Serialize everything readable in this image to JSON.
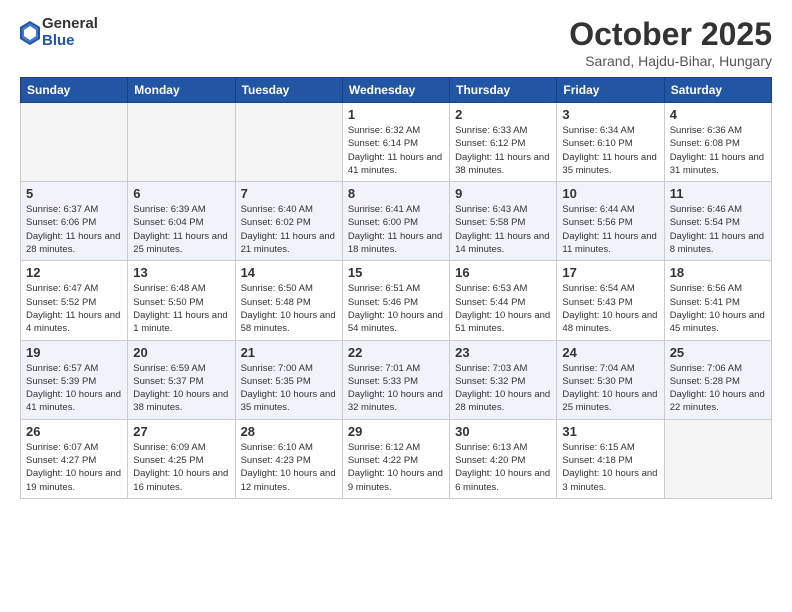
{
  "logo": {
    "general": "General",
    "blue": "Blue"
  },
  "title": "October 2025",
  "subtitle": "Sarand, Hajdu-Bihar, Hungary",
  "weekdays": [
    "Sunday",
    "Monday",
    "Tuesday",
    "Wednesday",
    "Thursday",
    "Friday",
    "Saturday"
  ],
  "weeks": [
    [
      {
        "day": "",
        "sunrise": "",
        "sunset": "",
        "daylight": ""
      },
      {
        "day": "",
        "sunrise": "",
        "sunset": "",
        "daylight": ""
      },
      {
        "day": "",
        "sunrise": "",
        "sunset": "",
        "daylight": ""
      },
      {
        "day": "1",
        "sunrise": "Sunrise: 6:32 AM",
        "sunset": "Sunset: 6:14 PM",
        "daylight": "Daylight: 11 hours and 41 minutes."
      },
      {
        "day": "2",
        "sunrise": "Sunrise: 6:33 AM",
        "sunset": "Sunset: 6:12 PM",
        "daylight": "Daylight: 11 hours and 38 minutes."
      },
      {
        "day": "3",
        "sunrise": "Sunrise: 6:34 AM",
        "sunset": "Sunset: 6:10 PM",
        "daylight": "Daylight: 11 hours and 35 minutes."
      },
      {
        "day": "4",
        "sunrise": "Sunrise: 6:36 AM",
        "sunset": "Sunset: 6:08 PM",
        "daylight": "Daylight: 11 hours and 31 minutes."
      }
    ],
    [
      {
        "day": "5",
        "sunrise": "Sunrise: 6:37 AM",
        "sunset": "Sunset: 6:06 PM",
        "daylight": "Daylight: 11 hours and 28 minutes."
      },
      {
        "day": "6",
        "sunrise": "Sunrise: 6:39 AM",
        "sunset": "Sunset: 6:04 PM",
        "daylight": "Daylight: 11 hours and 25 minutes."
      },
      {
        "day": "7",
        "sunrise": "Sunrise: 6:40 AM",
        "sunset": "Sunset: 6:02 PM",
        "daylight": "Daylight: 11 hours and 21 minutes."
      },
      {
        "day": "8",
        "sunrise": "Sunrise: 6:41 AM",
        "sunset": "Sunset: 6:00 PM",
        "daylight": "Daylight: 11 hours and 18 minutes."
      },
      {
        "day": "9",
        "sunrise": "Sunrise: 6:43 AM",
        "sunset": "Sunset: 5:58 PM",
        "daylight": "Daylight: 11 hours and 14 minutes."
      },
      {
        "day": "10",
        "sunrise": "Sunrise: 6:44 AM",
        "sunset": "Sunset: 5:56 PM",
        "daylight": "Daylight: 11 hours and 11 minutes."
      },
      {
        "day": "11",
        "sunrise": "Sunrise: 6:46 AM",
        "sunset": "Sunset: 5:54 PM",
        "daylight": "Daylight: 11 hours and 8 minutes."
      }
    ],
    [
      {
        "day": "12",
        "sunrise": "Sunrise: 6:47 AM",
        "sunset": "Sunset: 5:52 PM",
        "daylight": "Daylight: 11 hours and 4 minutes."
      },
      {
        "day": "13",
        "sunrise": "Sunrise: 6:48 AM",
        "sunset": "Sunset: 5:50 PM",
        "daylight": "Daylight: 11 hours and 1 minute."
      },
      {
        "day": "14",
        "sunrise": "Sunrise: 6:50 AM",
        "sunset": "Sunset: 5:48 PM",
        "daylight": "Daylight: 10 hours and 58 minutes."
      },
      {
        "day": "15",
        "sunrise": "Sunrise: 6:51 AM",
        "sunset": "Sunset: 5:46 PM",
        "daylight": "Daylight: 10 hours and 54 minutes."
      },
      {
        "day": "16",
        "sunrise": "Sunrise: 6:53 AM",
        "sunset": "Sunset: 5:44 PM",
        "daylight": "Daylight: 10 hours and 51 minutes."
      },
      {
        "day": "17",
        "sunrise": "Sunrise: 6:54 AM",
        "sunset": "Sunset: 5:43 PM",
        "daylight": "Daylight: 10 hours and 48 minutes."
      },
      {
        "day": "18",
        "sunrise": "Sunrise: 6:56 AM",
        "sunset": "Sunset: 5:41 PM",
        "daylight": "Daylight: 10 hours and 45 minutes."
      }
    ],
    [
      {
        "day": "19",
        "sunrise": "Sunrise: 6:57 AM",
        "sunset": "Sunset: 5:39 PM",
        "daylight": "Daylight: 10 hours and 41 minutes."
      },
      {
        "day": "20",
        "sunrise": "Sunrise: 6:59 AM",
        "sunset": "Sunset: 5:37 PM",
        "daylight": "Daylight: 10 hours and 38 minutes."
      },
      {
        "day": "21",
        "sunrise": "Sunrise: 7:00 AM",
        "sunset": "Sunset: 5:35 PM",
        "daylight": "Daylight: 10 hours and 35 minutes."
      },
      {
        "day": "22",
        "sunrise": "Sunrise: 7:01 AM",
        "sunset": "Sunset: 5:33 PM",
        "daylight": "Daylight: 10 hours and 32 minutes."
      },
      {
        "day": "23",
        "sunrise": "Sunrise: 7:03 AM",
        "sunset": "Sunset: 5:32 PM",
        "daylight": "Daylight: 10 hours and 28 minutes."
      },
      {
        "day": "24",
        "sunrise": "Sunrise: 7:04 AM",
        "sunset": "Sunset: 5:30 PM",
        "daylight": "Daylight: 10 hours and 25 minutes."
      },
      {
        "day": "25",
        "sunrise": "Sunrise: 7:06 AM",
        "sunset": "Sunset: 5:28 PM",
        "daylight": "Daylight: 10 hours and 22 minutes."
      }
    ],
    [
      {
        "day": "26",
        "sunrise": "Sunrise: 6:07 AM",
        "sunset": "Sunset: 4:27 PM",
        "daylight": "Daylight: 10 hours and 19 minutes."
      },
      {
        "day": "27",
        "sunrise": "Sunrise: 6:09 AM",
        "sunset": "Sunset: 4:25 PM",
        "daylight": "Daylight: 10 hours and 16 minutes."
      },
      {
        "day": "28",
        "sunrise": "Sunrise: 6:10 AM",
        "sunset": "Sunset: 4:23 PM",
        "daylight": "Daylight: 10 hours and 12 minutes."
      },
      {
        "day": "29",
        "sunrise": "Sunrise: 6:12 AM",
        "sunset": "Sunset: 4:22 PM",
        "daylight": "Daylight: 10 hours and 9 minutes."
      },
      {
        "day": "30",
        "sunrise": "Sunrise: 6:13 AM",
        "sunset": "Sunset: 4:20 PM",
        "daylight": "Daylight: 10 hours and 6 minutes."
      },
      {
        "day": "31",
        "sunrise": "Sunrise: 6:15 AM",
        "sunset": "Sunset: 4:18 PM",
        "daylight": "Daylight: 10 hours and 3 minutes."
      },
      {
        "day": "",
        "sunrise": "",
        "sunset": "",
        "daylight": ""
      }
    ]
  ]
}
